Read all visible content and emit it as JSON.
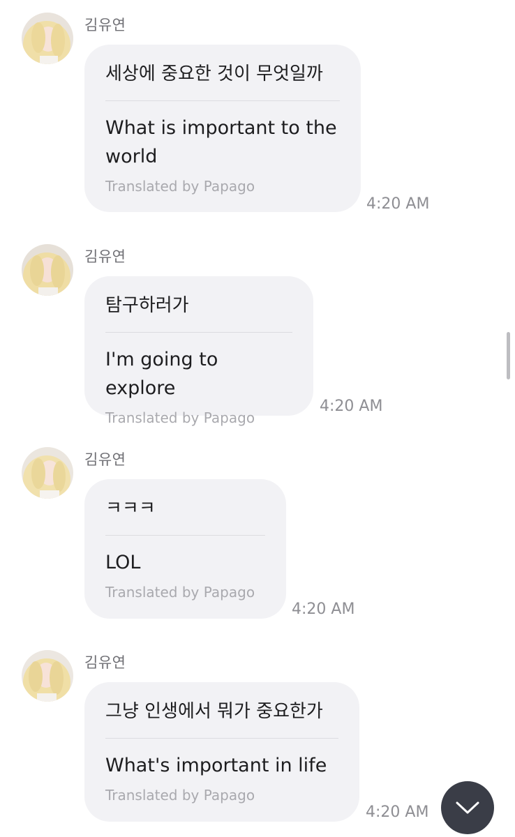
{
  "messages": [
    {
      "sender": "김유연",
      "original": "세상에 중요한 것이 무엇일까",
      "translation": "What is important to the world",
      "credit": "Translated by Papago",
      "time": "4:20 AM"
    },
    {
      "sender": "김유연",
      "original": "탐구하러가",
      "translation": "I'm going to explore",
      "credit": "Translated by Papago",
      "time": "4:20 AM"
    },
    {
      "sender": "김유연",
      "original": "ㅋㅋㅋ",
      "translation": "LOL",
      "credit": "Translated by Papago",
      "time": "4:20 AM"
    },
    {
      "sender": "김유연",
      "original": "그냥 인생에서 뭐가 중요한가",
      "translation": "What's important in life",
      "credit": "Translated by Papago",
      "time": "4:20 AM"
    }
  ],
  "icons": {
    "scroll_down": "chevron-down-icon",
    "avatar": "profile-photo"
  },
  "colors": {
    "bubble": "#f2f2f5",
    "scroll_button": "#3a3d47",
    "credit_text": "#a9a9ae"
  }
}
